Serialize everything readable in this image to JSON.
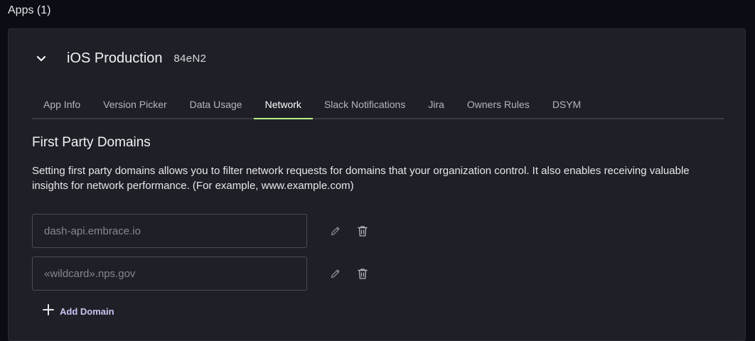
{
  "apps_header": "Apps (1)",
  "app": {
    "name": "iOS Production",
    "id": "84eN2"
  },
  "tabs": [
    {
      "label": "App Info",
      "active": false
    },
    {
      "label": "Version Picker",
      "active": false
    },
    {
      "label": "Data Usage",
      "active": false
    },
    {
      "label": "Network",
      "active": true
    },
    {
      "label": "Slack Notifications",
      "active": false
    },
    {
      "label": "Jira",
      "active": false
    },
    {
      "label": "Owners Rules",
      "active": false
    },
    {
      "label": "DSYM",
      "active": false
    }
  ],
  "section": {
    "title": "First Party Domains",
    "description": "Setting first party domains allows you to filter network requests for domains that your organization control. It also enables receiving valuable insights for network performance. (For example, www.example.com)"
  },
  "domains": [
    {
      "value": "dash-api.embrace.io"
    },
    {
      "value": "«wildcard».nps.gov"
    }
  ],
  "add_domain_label": "Add Domain",
  "colors": {
    "accent_tab_underline": "#b6f08a",
    "add_domain_text": "#c9c4f2",
    "card_background": "#1f2027",
    "page_background": "#0b0d14"
  },
  "icons": {
    "collapse": "chevron-down-icon",
    "edit": "pencil-icon",
    "delete": "trash-icon",
    "add": "plus-icon"
  }
}
